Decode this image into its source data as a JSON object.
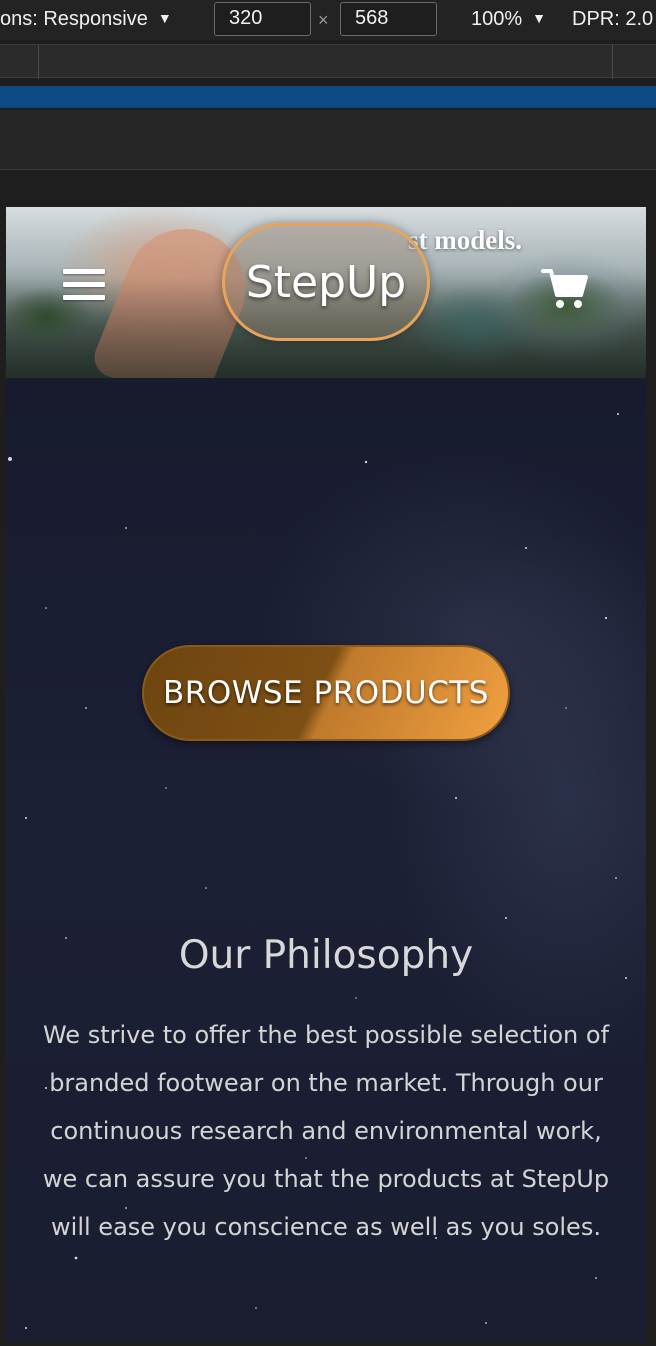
{
  "devtools": {
    "dimensions_label": "ons: Responsive",
    "width_value": "320",
    "times_symbol": "×",
    "height_value": "568",
    "zoom": "100%",
    "dpr": "DPR: 2.0",
    "caret_glyph": "▼"
  },
  "site": {
    "tagline": "st models.",
    "logo_text": "StepUp",
    "menu_icon": "hamburger-menu-icon",
    "cart_icon": "shopping-cart-icon",
    "browse_button_label": "BROWSE PRODUCTS",
    "philosophy": {
      "title": "Our Philosophy",
      "body": "We strive to offer the best possible selection of branded footwear on the market. Through our continuous research and environmental work, we can assure you that the products at StepUp will ease you conscience as well as you soles."
    }
  },
  "colors": {
    "accent_orange": "#f0a040",
    "devtools_blue": "#0e4a84",
    "space_bg": "#1c2035"
  }
}
